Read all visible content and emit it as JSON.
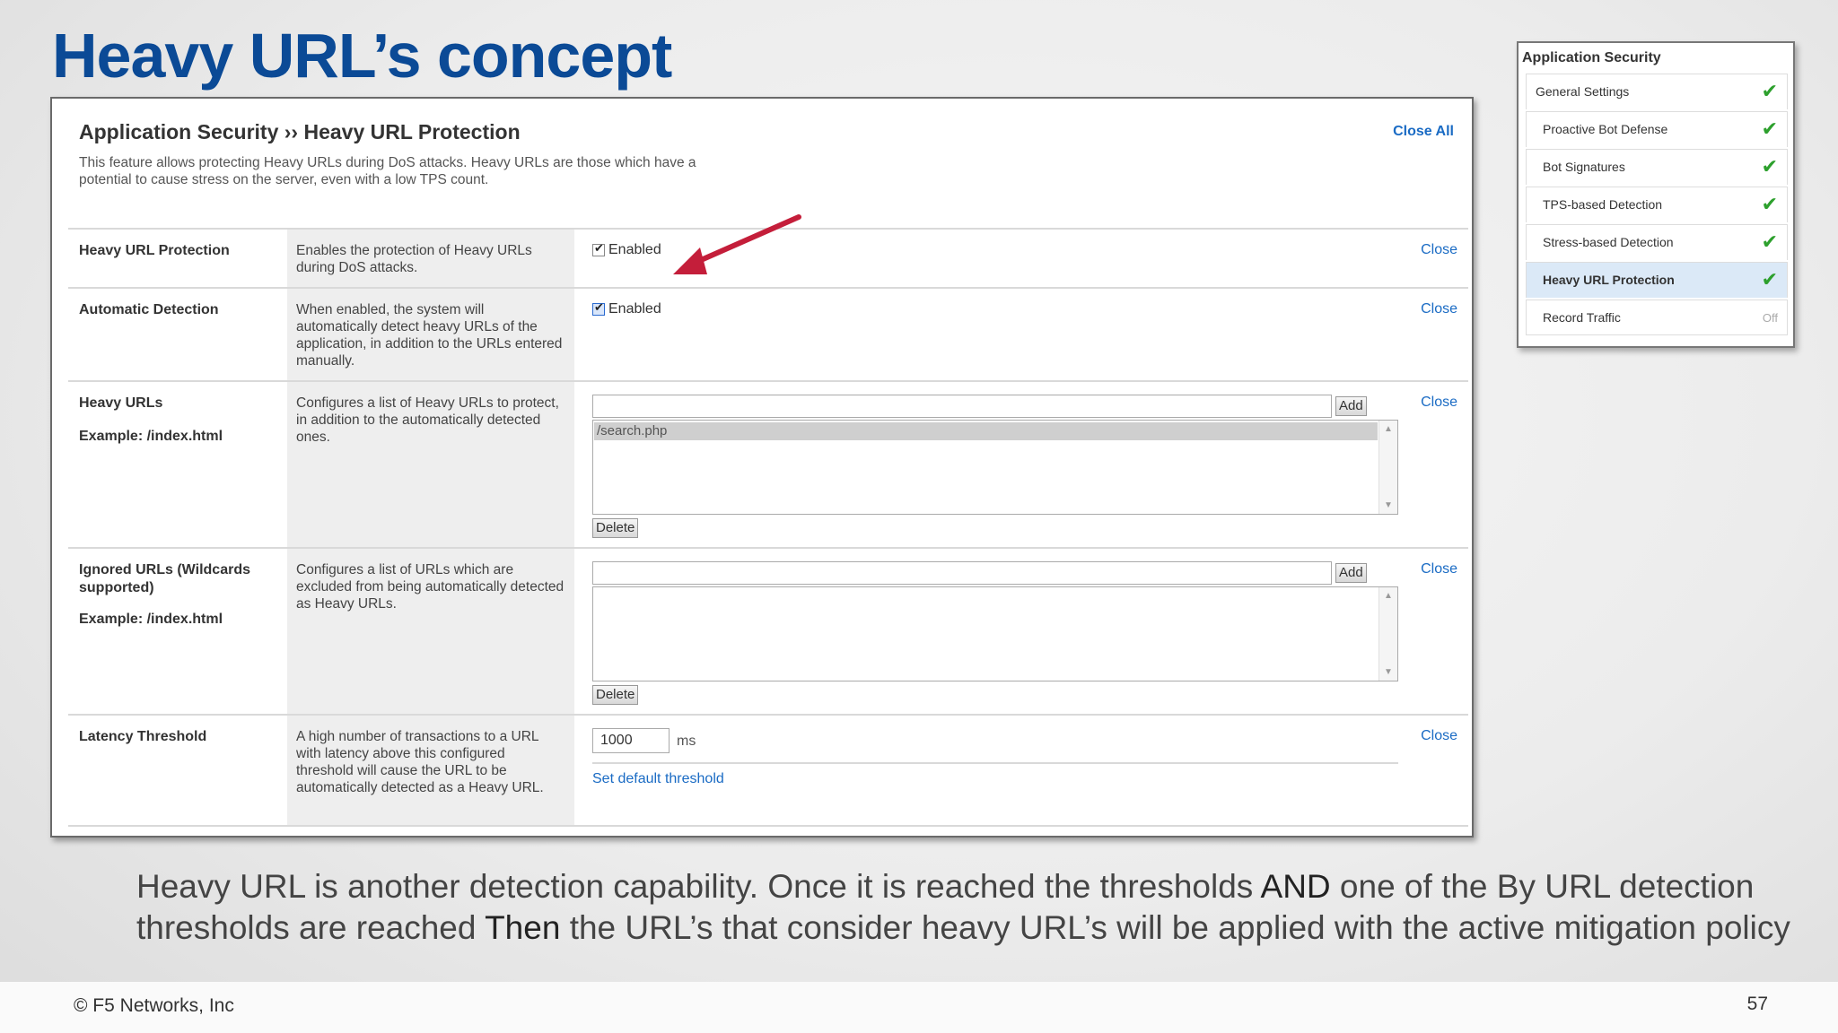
{
  "slide": {
    "title": "Heavy URL’s concept",
    "caption_parts": [
      "Heavy URL is another detection capability. Once it is reached the thresholds ",
      "AND",
      " one of the By URL detection thresholds are reached ",
      "Then",
      " the URL’s that consider heavy URL’s will be applied with the active mitigation policy"
    ],
    "copyright": "© F5 Networks, Inc",
    "page_number": "57"
  },
  "panel": {
    "title": "Application Security ›› Heavy URL Protection",
    "close_all": "Close All",
    "description": "This feature allows protecting Heavy URLs during DoS attacks. Heavy URLs are those which have a potential to cause stress on the server, even with a low TPS count."
  },
  "rows": {
    "protection": {
      "label": "Heavy URL Protection",
      "desc": "Enables the protection of Heavy URLs during DoS attacks.",
      "checkbox_label": "Enabled",
      "checked": true,
      "close": "Close"
    },
    "auto_detect": {
      "label": "Automatic Detection",
      "desc": "When enabled, the system will automatically detect heavy URLs of the application, in addition to the URLs entered manually.",
      "checkbox_label": "Enabled",
      "checked": true,
      "close": "Close"
    },
    "heavy_urls": {
      "label": "Heavy URLs",
      "example": "Example: /index.html",
      "desc": "Configures a list of Heavy URLs to protect, in addition to the automatically detected ones.",
      "input_value": "",
      "add_label": "Add",
      "list_items": [
        "/search.php"
      ],
      "delete_label": "Delete",
      "close": "Close"
    },
    "ignored_urls": {
      "label": "Ignored URLs (Wildcards supported)",
      "example": "Example: /index.html",
      "desc": "Configures a list of URLs which are excluded from being automatically detected as Heavy URLs.",
      "input_value": "",
      "add_label": "Add",
      "list_items": [],
      "delete_label": "Delete",
      "close": "Close"
    },
    "latency": {
      "label": "Latency Threshold",
      "desc": "A high number of transactions to a URL with latency above this configured threshold will cause the URL to be automatically detected as a Heavy URL.",
      "value": "1000",
      "unit": "ms",
      "set_default": "Set default threshold",
      "close": "Close"
    }
  },
  "sidebar": {
    "title": "Application Security",
    "items": [
      {
        "label": "General Settings",
        "status": "check"
      },
      {
        "label": "Proactive Bot Defense",
        "status": "check"
      },
      {
        "label": "Bot Signatures",
        "status": "check"
      },
      {
        "label": "TPS-based Detection",
        "status": "check"
      },
      {
        "label": "Stress-based Detection",
        "status": "check"
      },
      {
        "label": "Heavy URL Protection",
        "status": "check",
        "active": true
      },
      {
        "label": "Record Traffic",
        "status": "Off"
      }
    ]
  },
  "colors": {
    "title_blue": "#0b4a96",
    "link_blue": "#1a6bc4",
    "check_green": "#2da02d",
    "arrow_red": "#c41e3a",
    "active_bg": "#dbe9f7"
  },
  "icons": {
    "check": "checkmark-icon",
    "arrow": "red-pointer-arrow"
  }
}
